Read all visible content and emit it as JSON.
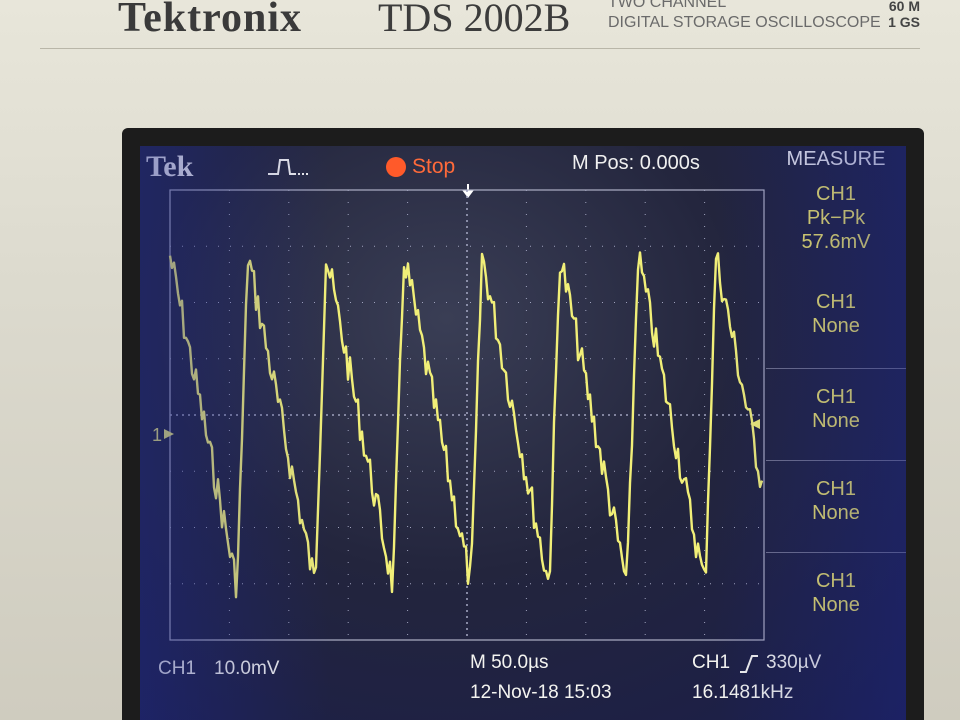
{
  "bezel": {
    "brand": "Tektronix",
    "model": "TDS 2002B",
    "model_sub1": "TWO CHANNEL",
    "model_sub2": "DIGITAL STORAGE OSCILLOSCOPE",
    "spec_bandwidth": "60 M",
    "spec_rate": "1 GS"
  },
  "header": {
    "logo": "Tek",
    "trigger_icon": "trigger-pulse-icon",
    "run_state": "Stop",
    "m_pos": "M Pos: 0.000s"
  },
  "measure": {
    "title": "MEASURE",
    "slots": [
      {
        "source": "CH1",
        "type": "Pk−Pk",
        "value": "57.6mV"
      },
      {
        "source": "CH1",
        "type": "None",
        "value": ""
      },
      {
        "source": "CH1",
        "type": "None",
        "value": ""
      },
      {
        "source": "CH1",
        "type": "None",
        "value": ""
      },
      {
        "source": "CH1",
        "type": "None",
        "value": ""
      }
    ]
  },
  "channel_marker": "1",
  "footer": {
    "ch1_label": "CH1",
    "ch1_scale": "10.0mV",
    "timebase": "M 50.0µs",
    "datetime": "12-Nov-18 15:03",
    "trigger_source": "CH1",
    "trigger_level": "330µV",
    "frequency": "16.1481kHz"
  },
  "colors": {
    "trace": "#f1ef78",
    "screen_bg": "#23253d",
    "stop": "#ff5a2a"
  }
}
